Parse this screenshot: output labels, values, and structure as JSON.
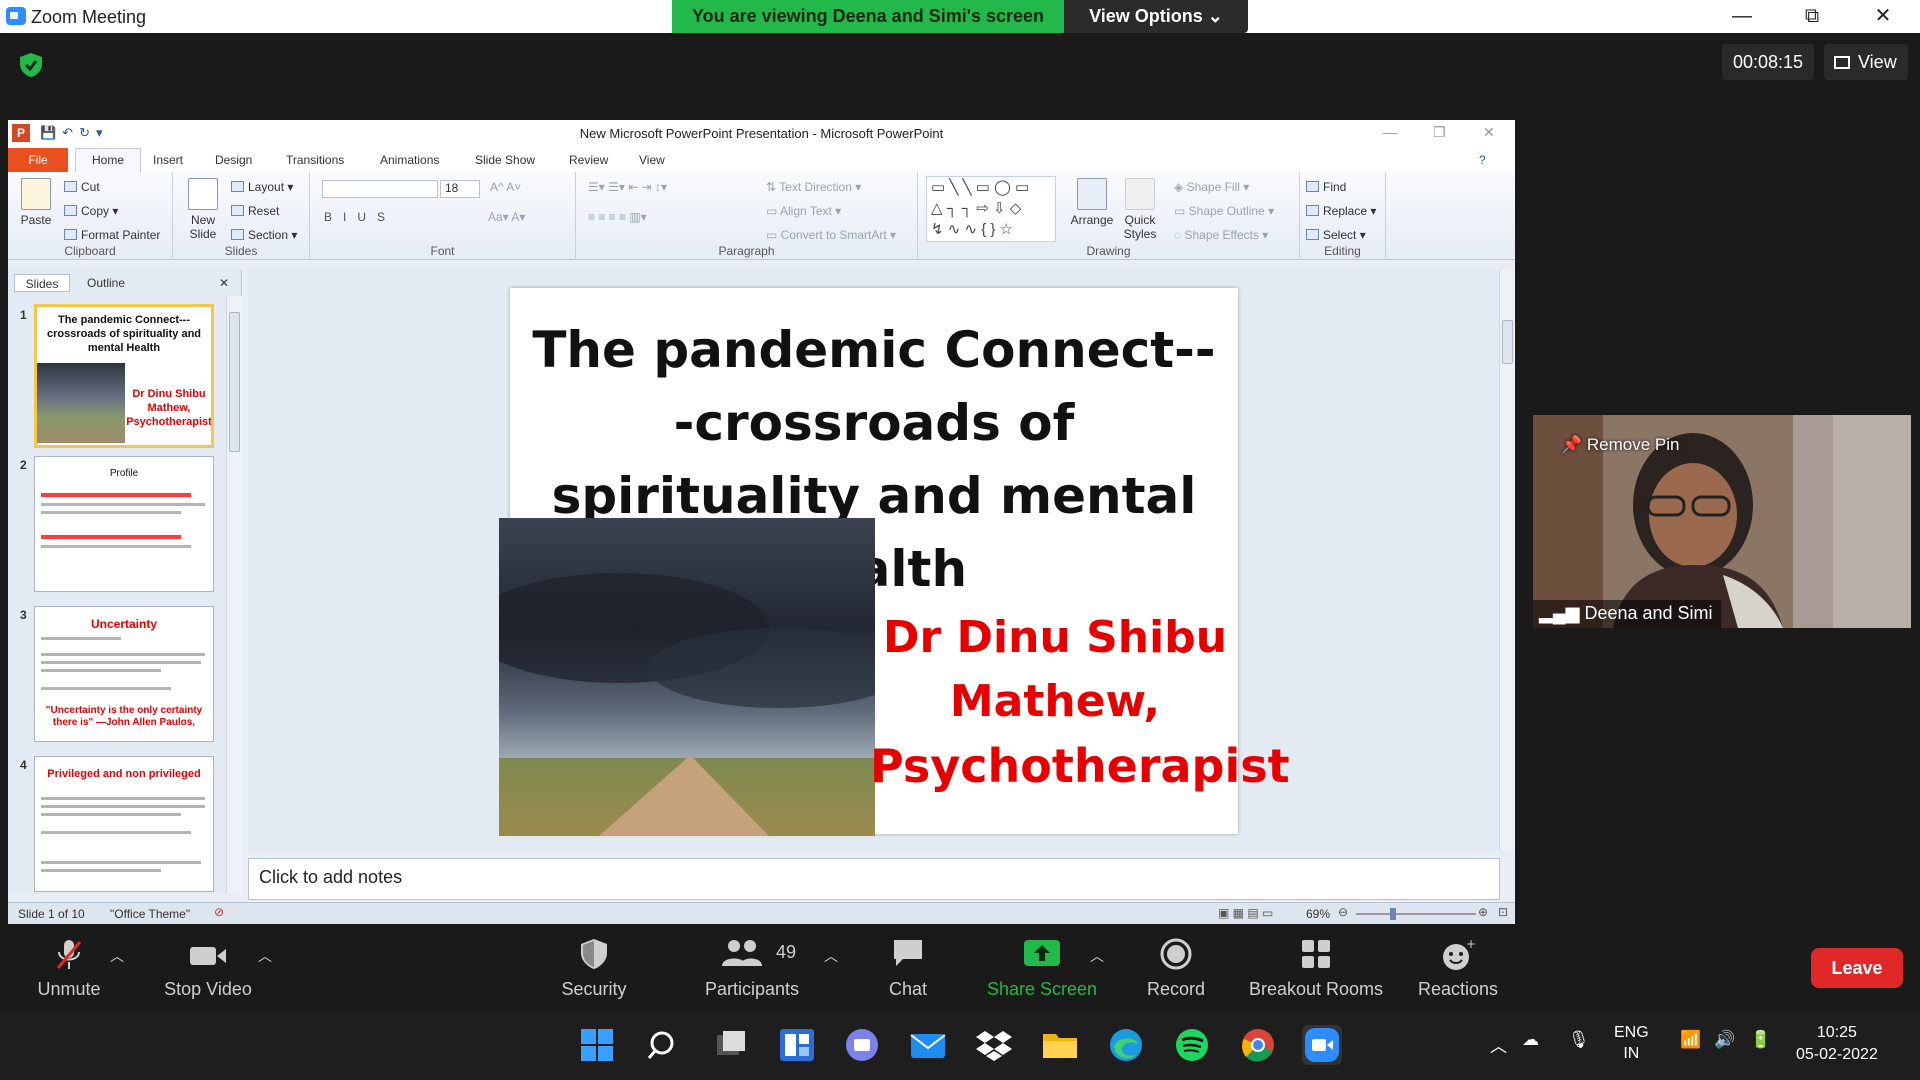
{
  "zoom": {
    "window_title": "Zoom Meeting",
    "share_banner": "You are viewing Deena and Simi's screen",
    "view_options_label": "View Options",
    "timer": "00:08:15",
    "view_label": "View",
    "minimize_glyph": "—",
    "maximize_glyph": "⧉",
    "close_glyph": "✕"
  },
  "powerpoint": {
    "app_letter": "P",
    "window_title": "New Microsoft PowerPoint Presentation  -  Microsoft PowerPoint",
    "tabs": [
      "File",
      "Home",
      "Insert",
      "Design",
      "Transitions",
      "Animations",
      "Slide Show",
      "Review",
      "View"
    ],
    "ribbon": {
      "clipboard": {
        "label": "Clipboard",
        "paste": "Paste",
        "cut": "Cut",
        "copy": "Copy",
        "format_painter": "Format Painter"
      },
      "slides": {
        "label": "Slides",
        "new_slide": "New Slide",
        "layout": "Layout",
        "reset": "Reset",
        "section": "Section"
      },
      "font": {
        "label": "Font",
        "font_size": "18"
      },
      "paragraph": {
        "label": "Paragraph",
        "text_direction": "Text Direction",
        "align_text": "Align Text",
        "convert_smartart": "Convert to SmartArt"
      },
      "drawing": {
        "label": "Drawing",
        "arrange": "Arrange",
        "quick_styles": "Quick Styles",
        "shape_fill": "Shape Fill",
        "shape_outline": "Shape Outline",
        "shape_effects": "Shape Effects"
      },
      "editing": {
        "label": "Editing",
        "find": "Find",
        "replace": "Replace",
        "select": "Select"
      }
    },
    "panel_tabs": [
      "Slides",
      "Outline"
    ],
    "thumbnails": [
      {
        "num": "1",
        "title": "The pandemic Connect--- crossroads of spirituality and mental Health",
        "author": "Dr Dinu Shibu Mathew, Psychotherapist"
      },
      {
        "num": "2",
        "title": "Profile"
      },
      {
        "num": "3",
        "title": "Uncertainty",
        "quote": "\"Uncertainty is the only certainty there is\" —John Allen Paulos,"
      },
      {
        "num": "4",
        "title": "Privileged and non privileged"
      }
    ],
    "slide": {
      "title": "The pandemic Connect---crossroads of spirituality and mental Health",
      "author_line1": "Dr Dinu Shibu",
      "author_line2": "Mathew,",
      "author_line3": "Psychotherapist"
    },
    "notes_placeholder": "Click to add notes",
    "status": {
      "slide_count": "Slide 1 of 10",
      "theme": "\"Office Theme\"",
      "zoom": "69%"
    }
  },
  "participant": {
    "remove_pin": "Remove Pin",
    "name": "Deena and Simi"
  },
  "toolbar": {
    "unmute": "Unmute",
    "stop_video": "Stop Video",
    "security": "Security",
    "participants": "Participants",
    "participant_count": "49",
    "chat": "Chat",
    "share_screen": "Share Screen",
    "record": "Record",
    "breakout_rooms": "Breakout Rooms",
    "reactions": "Reactions",
    "leave": "Leave"
  },
  "taskbar": {
    "lang1": "ENG",
    "lang2": "IN",
    "time": "10:25",
    "date": "05-02-2022"
  },
  "colors": {
    "zoom_green": "#23b84a",
    "leave_red": "#e02828",
    "slide_red": "#e60000",
    "ppt_orange": "#e8501f"
  }
}
